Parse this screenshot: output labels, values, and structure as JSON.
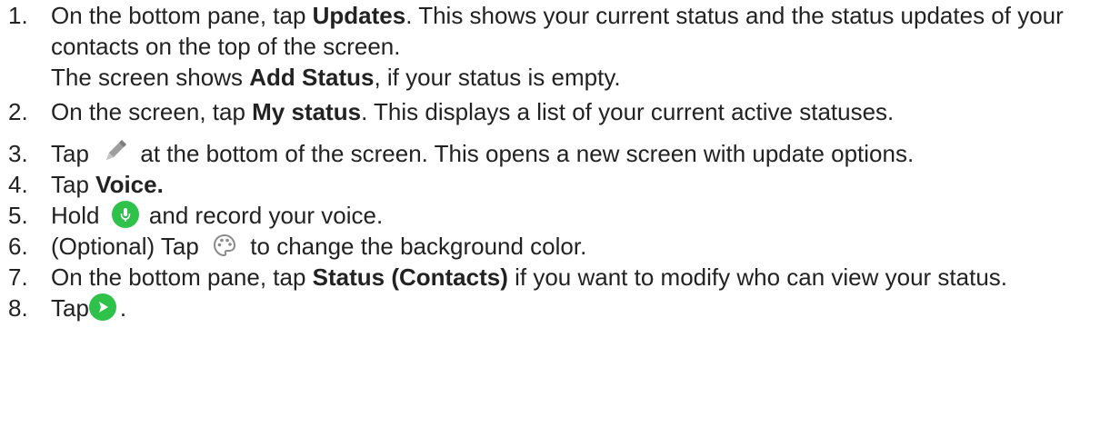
{
  "steps": [
    {
      "num": "1.",
      "t1": "On the bottom pane, tap ",
      "b1": "Updates",
      "t2": ". This shows your current status and the status updates of your contacts on the top of the screen.",
      "sub_t1": "The screen shows ",
      "sub_b1": "Add Status",
      "sub_t2": ", if your status is empty."
    },
    {
      "num": "2.",
      "t1": "On the screen, tap ",
      "b1": "My status",
      "t2": ". This displays a list of your current active statuses."
    },
    {
      "num": "3.",
      "t1": "Tap ",
      "icon": "pencil-icon",
      "t2": " at the bottom of the screen. This opens a new screen with update options."
    },
    {
      "num": "4.",
      "t1": "Tap ",
      "b1": "Voice."
    },
    {
      "num": "5.",
      "t1": "Hold ",
      "icon": "mic-icon",
      "t2": " and record your voice."
    },
    {
      "num": "6.",
      "t1": "(Optional) Tap ",
      "icon": "palette-icon",
      "t2": " to change the background color."
    },
    {
      "num": "7.",
      "t1": "On the bottom pane, tap ",
      "b1": "Status (Contacts)",
      "t2": " if you want to modify who can view your status."
    },
    {
      "num": "8.",
      "t1": "Tap",
      "icon": "send-icon",
      "t2": "."
    }
  ],
  "colors": {
    "text": "#222222",
    "accent_green": "#2fc24a",
    "icon_gray": "#9e9e9e"
  }
}
